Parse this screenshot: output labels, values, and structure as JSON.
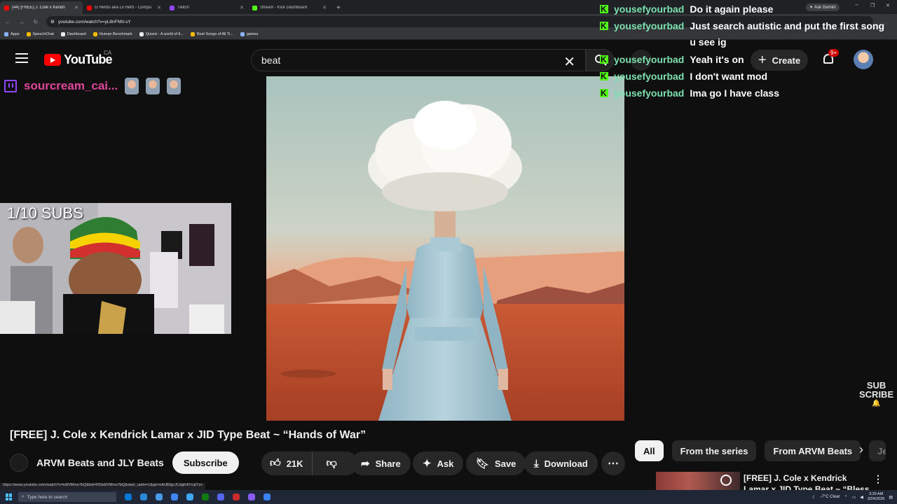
{
  "browser": {
    "tabs": [
      {
        "label": "(44) [FREE] J. Cole x Kendri",
        "favicon_color": "#ff0000",
        "active": true
      },
      {
        "label": "G Herbo aka Lil Herb - Compu",
        "favicon_color": "#ff0000",
        "active": false
      },
      {
        "label": "Twitch",
        "favicon_color": "#9146ff",
        "active": false
      },
      {
        "label": "Stream - Kick Dashboard",
        "favicon_color": "#53fc18",
        "active": false
      }
    ],
    "new_tab": "+",
    "ask_gemini": "Ask Gemini",
    "url": "youtube.com/watch?v=yL8nFNN-sY",
    "bookmarks": [
      {
        "label": "Apps",
        "color": "#8ab4f8"
      },
      {
        "label": "SpeechChat",
        "color": "#fbbc04"
      },
      {
        "label": "Dashboard",
        "color": "#e8eaed"
      },
      {
        "label": "Human Benchmark",
        "color": "#fbbc04"
      },
      {
        "label": "Quizizi - A world of fi...",
        "color": "#e8eaed"
      },
      {
        "label": "Best Songs of All Ti...",
        "color": "#fbbc04"
      },
      {
        "label": "games",
        "color": "#8ab4f8"
      }
    ],
    "status_url": "https://www.youtube.com/watch?v=ix8VMmo7bQ&list=RDix8VMmo7bQ&start_radio=1&pp=oAcB0gcJCdgKAYcqIYzv"
  },
  "youtube": {
    "logo_text": "YouTube",
    "country": "CA",
    "search_value": "beat",
    "create_label": "Create",
    "notification_count": "9+"
  },
  "stream": {
    "streamer_name": "sourcream_cai...",
    "cam_label": "1/10 SUBS",
    "subscribe_corner": [
      "SUB",
      "SCRIBE"
    ]
  },
  "chat": [
    {
      "user": "yousefyourbad",
      "text": "Do it again please"
    },
    {
      "user": "yousefyourbad",
      "text": "Just search autistic and put the first song u see ig"
    },
    {
      "user": "yousefyourbad",
      "text": "Yeah it's on"
    },
    {
      "user": "yousefyourbad",
      "text": "I don't want mod"
    },
    {
      "user": "yousefyourbad",
      "text": "Ima go I have class"
    }
  ],
  "video": {
    "title": "[FREE] J. Cole x Kendrick Lamar x JID Type Beat ~ “Hands of War”",
    "channel": "ARVM Beats and JLY Beats",
    "subscribe_label": "Subscribe",
    "likes": "21K",
    "share_label": "Share",
    "ask_label": "Ask",
    "save_label": "Save",
    "download_label": "Download"
  },
  "sidebar": {
    "chips": [
      "All",
      "From the series",
      "From ARVM Beats",
      "Je"
    ],
    "rec_title": "[FREE] J. Cole x Kendrick Lamar x JID Type Beat ~ “Bless Your"
  },
  "taskbar": {
    "search_placeholder": "Type here to search",
    "weather": "-7°C Clear",
    "time": "3:29 AM",
    "date": "3/24/2026"
  }
}
